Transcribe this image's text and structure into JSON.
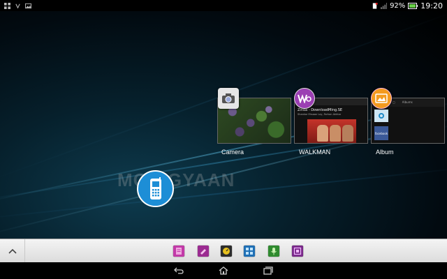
{
  "status_bar": {
    "battery_percent": "92%",
    "time": "19:20"
  },
  "watermark": "MOBIGYAAN",
  "recent_apps": [
    {
      "label": "Camera",
      "icon": "camera-icon",
      "color": "#e6e6e6"
    },
    {
      "label": "WALKMAN",
      "icon": "walkman-icon",
      "color": "#9b3fb3"
    },
    {
      "label": "Album",
      "icon": "album-icon",
      "color": "#f39a1e"
    }
  ],
  "walkman_preview": {
    "title": "Zinda - DownloadMing.SE",
    "subtitle": "Shankar Ehsaan Loy, Farhan Akhtar"
  },
  "album_preview": {
    "tab_label": "Albums",
    "facebook_label": "facebook"
  },
  "dock": {
    "apps": [
      {
        "icon": "notes-icon",
        "color": "#c23aa8"
      },
      {
        "icon": "eraser-icon",
        "color": "#9b2b91"
      },
      {
        "icon": "timer-icon",
        "color": "#2c2c2c"
      },
      {
        "icon": "calculator-icon",
        "color": "#1f6fb5"
      },
      {
        "icon": "microphone-icon",
        "color": "#2f8a2f"
      },
      {
        "icon": "browser-icon",
        "color": "#7a2a8a"
      }
    ]
  },
  "colors": {
    "accent": "#1d8ed6",
    "dock_bg": "#e6e6e6"
  }
}
